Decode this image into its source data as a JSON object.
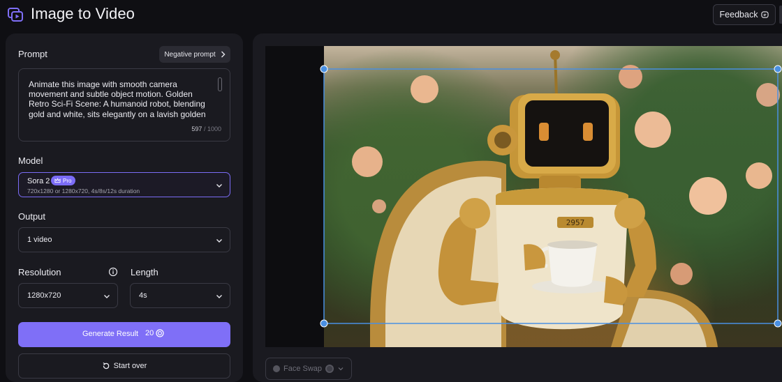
{
  "app": {
    "title": "Image to Video",
    "icon": "image-to-video-icon"
  },
  "header": {
    "feedback_label": "Feedback",
    "feedback_icon": "chat-icon"
  },
  "prompt": {
    "label": "Prompt",
    "negative_prompt_label": "Negative prompt",
    "text": "Animate this image with smooth camera movement and subtle object motion. Golden Retro Sci-Fi Scene: A humanoid robot, blending gold and white, sits elegantly on a lavish golden",
    "count": "597",
    "max": "/ 1000"
  },
  "model": {
    "label": "Model",
    "name": "Sora 2",
    "badge": "Pro",
    "description": "720x1280 or 1280x720, 4s/8s/12s duration"
  },
  "output": {
    "label": "Output",
    "value": "1 video"
  },
  "resolution": {
    "label": "Resolution",
    "value": "1280x720"
  },
  "length": {
    "label": "Length",
    "value": "4s"
  },
  "actions": {
    "generate_label": "Generate Result",
    "credits": "20",
    "start_over_label": "Start over"
  },
  "preview": {
    "robot_plate": "2957"
  },
  "face_swap": {
    "label": "Face Swap"
  },
  "colors": {
    "accent": "#7f6ff7",
    "selection": "#4a90e2",
    "gold": "#c89a3a"
  }
}
